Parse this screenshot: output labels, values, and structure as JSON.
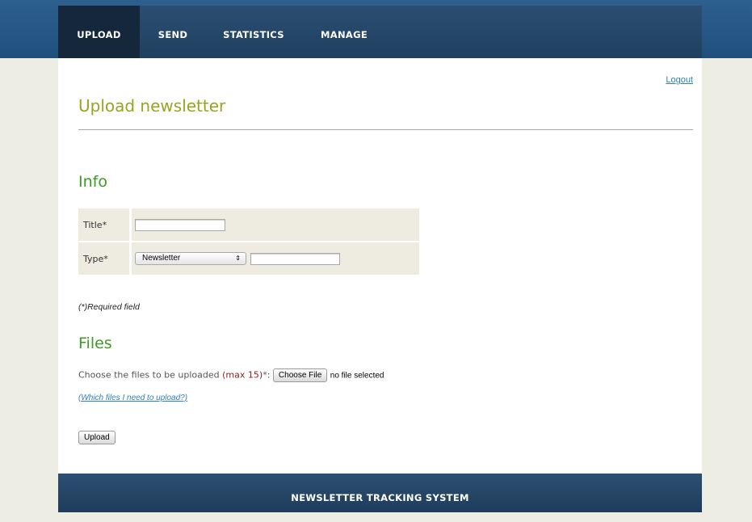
{
  "nav": {
    "items": [
      {
        "label": "UPLOAD",
        "active": true
      },
      {
        "label": "SEND",
        "active": false
      },
      {
        "label": "STATISTICS",
        "active": false
      },
      {
        "label": "MANAGE",
        "active": false
      }
    ]
  },
  "header": {
    "logout": "Logout",
    "title": "Upload newsletter"
  },
  "info": {
    "heading": "Info",
    "title_label": "Title*",
    "title_value": "",
    "type_label": "Type*",
    "type_selected": "Newsletter",
    "type_other_value": "",
    "required_note": "(*)Required field"
  },
  "files": {
    "heading": "Files",
    "choose_text": "Choose the files to be uploaded",
    "max_text": "(max 15)",
    "choose_suffix": "*:",
    "choose_button": "Choose File",
    "no_file": "no file selected",
    "which_link": "(Which files I need to upload?)",
    "upload_button": "Upload"
  },
  "footer": {
    "text": "NEWSLETTER TRACKING SYSTEM"
  },
  "colors": {
    "top_band": "#2d5f8f",
    "nav_bg": "#2a4e72",
    "nav_active": "#15283b",
    "page_title": "#9aa321",
    "section_title": "#3e9a25",
    "link": "#2f7fc1",
    "max_text": "#8c1d1d"
  }
}
